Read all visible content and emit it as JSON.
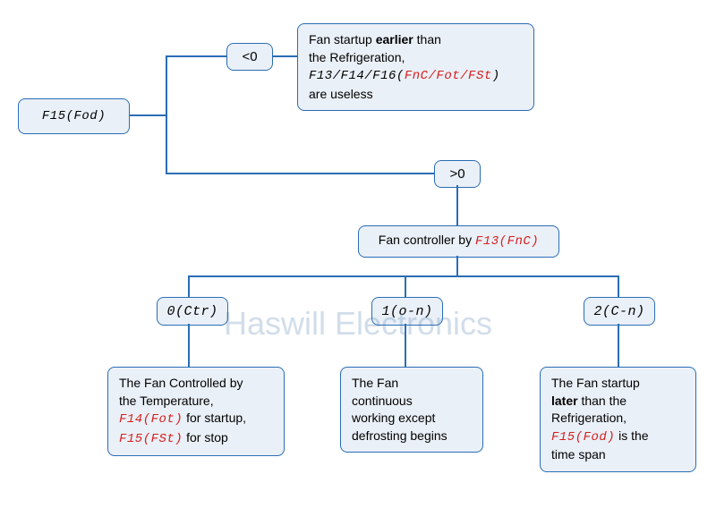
{
  "root": {
    "label": "F15(Fod)"
  },
  "branch_top": {
    "condition": "<0",
    "desc_line1_a": "Fan startup ",
    "desc_line1_b": "earlier",
    "desc_line1_c": " than",
    "desc_line2": "the Refrigeration,",
    "desc_line3_a": "F13/F14/F16(",
    "desc_line3_b": "FnC/Fot/FSt",
    "desc_line3_c": ")",
    "desc_line4": "are useless"
  },
  "branch_mid": {
    "condition": ">0",
    "controller_a": "Fan controller by ",
    "controller_b": "F13(FnC)"
  },
  "options": {
    "opt0": {
      "label": "0(Ctr)",
      "line1": "The Fan Controlled by",
      "line2": "the Temperature,",
      "line3_a": "F14(Fot)",
      "line3_b": " for startup,",
      "line4_a": "F15(FSt)",
      "line4_b": " for stop"
    },
    "opt1": {
      "label": "1(o-n)",
      "line1": "The Fan",
      "line2": "continuous",
      "line3": "working except",
      "line4": "defrosting begins"
    },
    "opt2": {
      "label": "2(C-n)",
      "line1": "The Fan startup",
      "line2_a": "later",
      "line2_b": " than the",
      "line3": "Refrigeration,",
      "line4_a": "F15(Fod)",
      "line4_b": " is the",
      "line5": "time span"
    }
  },
  "watermark": "Haswill Electronics"
}
